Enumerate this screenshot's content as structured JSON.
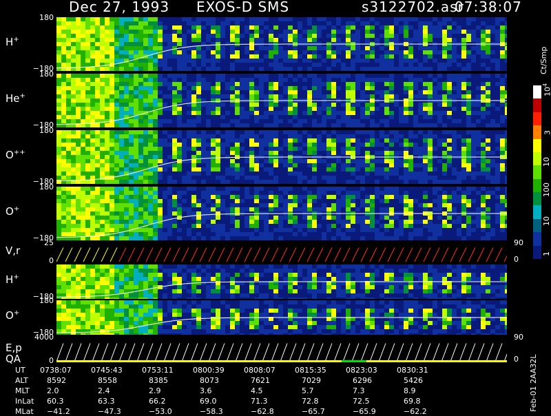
{
  "header": {
    "date": "Dec 27, 1993",
    "instrument": "EXOS-D SMS",
    "file": "s3122702.asr",
    "time": "07:38:07"
  },
  "panels": [
    {
      "id": "h",
      "label_main": "H",
      "label_sup": "+",
      "top": "180",
      "bottom": "−180"
    },
    {
      "id": "he",
      "label_main": "He",
      "label_sup": "+",
      "top": "180",
      "bottom": "−180"
    },
    {
      "id": "opp",
      "label_main": "O",
      "label_sup": "++",
      "top": "180",
      "bottom": "−180"
    },
    {
      "id": "o",
      "label_main": "O",
      "label_sup": "+",
      "top": "180",
      "bottom": "−180"
    },
    {
      "id": "vr",
      "label_main": "V,r",
      "top": "25",
      "bottom": "0",
      "right_top": "90",
      "right_bottom": "0"
    },
    {
      "id": "h2",
      "label_main": "H",
      "label_sup": "+",
      "bottom": "−180"
    },
    {
      "id": "o2",
      "label_main": "O",
      "label_sup": "+",
      "top": "180",
      "bottom": "−180"
    },
    {
      "id": "ep",
      "label_main": "E,p",
      "label_sub": "QA",
      "top": "4000",
      "bottom": "0",
      "right_top": "90",
      "right_bottom": "0"
    }
  ],
  "colorbar": {
    "unit": "Ct/Smp",
    "labels": [
      "10",
      "3",
      "10",
      "100",
      "10",
      "1"
    ],
    "sup_top": "4",
    "colors": [
      "#ffffff",
      "#c00000",
      "#ff2000",
      "#ff8000",
      "#ffff00",
      "#c0ff00",
      "#60e000",
      "#20b000",
      "#009040",
      "#00b0c0",
      "#006080",
      "#1030a0",
      "#0a1a7a"
    ]
  },
  "footer_side": "Feb-01 2AA32L",
  "ephemeris": {
    "row_labels": [
      "UT",
      "ALT",
      "MLT",
      "InLat",
      "MLat"
    ],
    "columns": [
      {
        "UT": "0738:07",
        "ALT": "8592",
        "MLT": "2.0",
        "InLat": "60.3",
        "MLat": "−41.2"
      },
      {
        "UT": "0745:43",
        "ALT": "8558",
        "MLT": "2.4",
        "InLat": "63.3",
        "MLat": "−47.3"
      },
      {
        "UT": "0753:11",
        "ALT": "8385",
        "MLT": "2.9",
        "InLat": "66.2",
        "MLat": "−53.0"
      },
      {
        "UT": "0800:39",
        "ALT": "8073",
        "MLT": "3.6",
        "InLat": "69.0",
        "MLat": "−58.3"
      },
      {
        "UT": "0808:07",
        "ALT": "7621",
        "MLT": "4.5",
        "InLat": "71.3",
        "MLat": "−62.8"
      },
      {
        "UT": "0815:35",
        "ALT": "7029",
        "MLT": "5.7",
        "InLat": "72.8",
        "MLat": "−65.7"
      },
      {
        "UT": "0823:03",
        "ALT": "6296",
        "MLT": "7.3",
        "InLat": "72.5",
        "MLat": "−65.9"
      },
      {
        "UT": "0830:31",
        "ALT": "5426",
        "MLT": "8.9",
        "InLat": "69.8",
        "MLat": "−62.2"
      }
    ]
  }
}
